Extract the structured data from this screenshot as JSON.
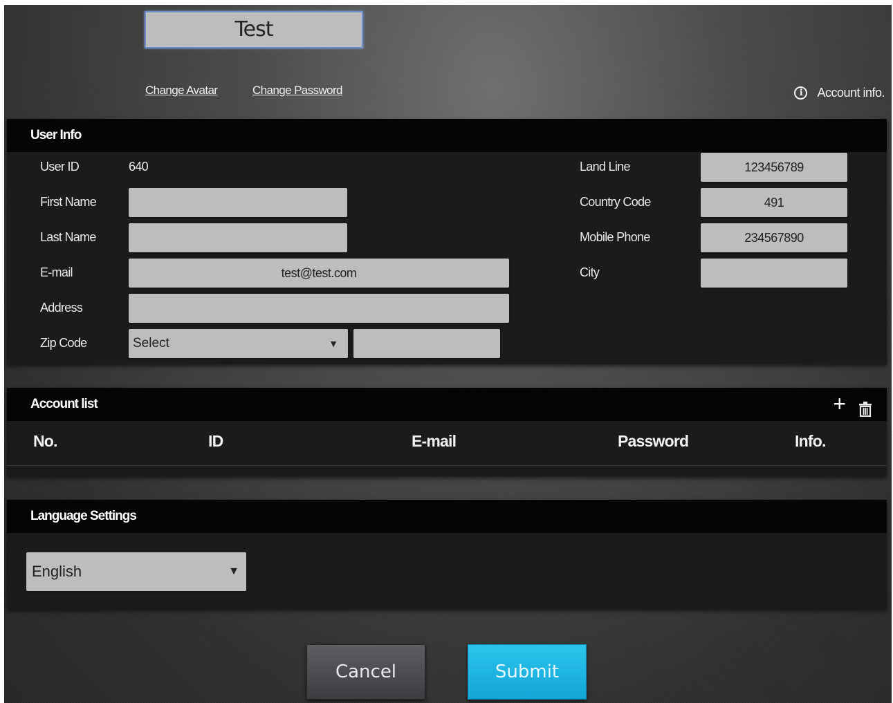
{
  "header": {
    "username": "Test",
    "change_avatar": "Change Avatar",
    "change_password": "Change Password",
    "account_info": "Account info.",
    "info_icon_glyph": "i"
  },
  "user_info": {
    "title": "User Info",
    "labels": {
      "user_id": "User ID",
      "first_name": "First Name",
      "last_name": "Last Name",
      "email": "E-mail",
      "address": "Address",
      "zip_code": "Zip Code",
      "land_line": "Land Line",
      "country_code": "Country Code",
      "mobile_phone": "Mobile Phone",
      "city": "City"
    },
    "values": {
      "user_id": "640",
      "first_name": "",
      "last_name": "",
      "email": "test@test.com",
      "address": "",
      "zip_select": "Select",
      "zip_code": "",
      "land_line": "123456789",
      "country_code": "491",
      "mobile_phone": "234567890",
      "city": ""
    }
  },
  "account_list": {
    "title": "Account list",
    "add_icon": "+",
    "columns": [
      "No.",
      "ID",
      "E-mail",
      "Password",
      "Info."
    ],
    "rows": []
  },
  "language": {
    "title": "Language Settings",
    "selected": "English",
    "arrow": "▼"
  },
  "buttons": {
    "cancel": "Cancel",
    "submit": "Submit"
  },
  "colors": {
    "submit_accent": "#1ab4e1",
    "panel_header": "#050505"
  }
}
